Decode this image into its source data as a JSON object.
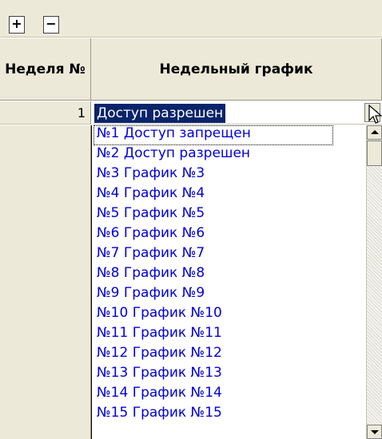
{
  "toolbar": {
    "add_icon": "plus-icon",
    "remove_icon": "minus-icon",
    "add_glyph": "+",
    "remove_glyph": "−"
  },
  "table": {
    "headers": [
      "Неделя №",
      "Недельный график"
    ],
    "row_number": "1",
    "selected_value": "Доступ разрешен"
  },
  "dropdown": {
    "items": [
      "№1 Доступ запрещен",
      "№2 Доступ разрешен",
      "№3 График №3",
      "№4 График №4",
      "№5 График №5",
      "№6 График №6",
      "№7 График №7",
      "№8 График №8",
      "№9 График №9",
      "№10 График №10",
      "№11 График №11",
      "№12 График №12",
      "№13 График №13",
      "№14 График №14",
      "№15 График №15"
    ]
  },
  "colors": {
    "selection_bg": "#0a246a",
    "list_text": "#0000d8",
    "panel": "#ece9d8"
  }
}
